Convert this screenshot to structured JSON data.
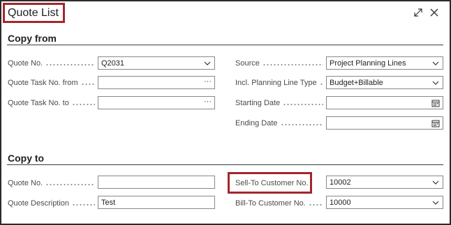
{
  "dialog": {
    "title": "Quote List",
    "expand_icon": "expand-icon",
    "close_icon": "close-icon"
  },
  "copy_from": {
    "heading": "Copy from",
    "quote_no": {
      "label": "Quote No.",
      "value": "Q2031",
      "icon": "chevron-down-icon"
    },
    "task_from": {
      "label": "Quote Task No. from",
      "value": "",
      "button": "···"
    },
    "task_to": {
      "label": "Quote Task No. to",
      "value": "",
      "button": "···"
    },
    "source": {
      "label": "Source",
      "value": "Project Planning Lines",
      "icon": "chevron-down-icon"
    },
    "planning_line_type": {
      "label": "Incl. Planning Line Type",
      "value": "Budget+Billable",
      "icon": "chevron-down-icon"
    },
    "starting_date": {
      "label": "Starting Date",
      "value": "",
      "icon": "calendar-icon"
    },
    "ending_date": {
      "label": "Ending Date",
      "value": "",
      "icon": "calendar-icon"
    }
  },
  "copy_to": {
    "heading": "Copy to",
    "quote_no": {
      "label": "Quote No.",
      "value": ""
    },
    "quote_description": {
      "label": "Quote Description",
      "value": "Test"
    },
    "sell_to": {
      "label": "Sell-To Customer No.",
      "value": "10002",
      "icon": "chevron-down-icon"
    },
    "bill_to": {
      "label": "Bill-To Customer No.",
      "value": "10000",
      "icon": "chevron-down-icon"
    }
  },
  "colors": {
    "highlight": "#a4262c",
    "border": "#8a8886",
    "text": "#212121"
  }
}
